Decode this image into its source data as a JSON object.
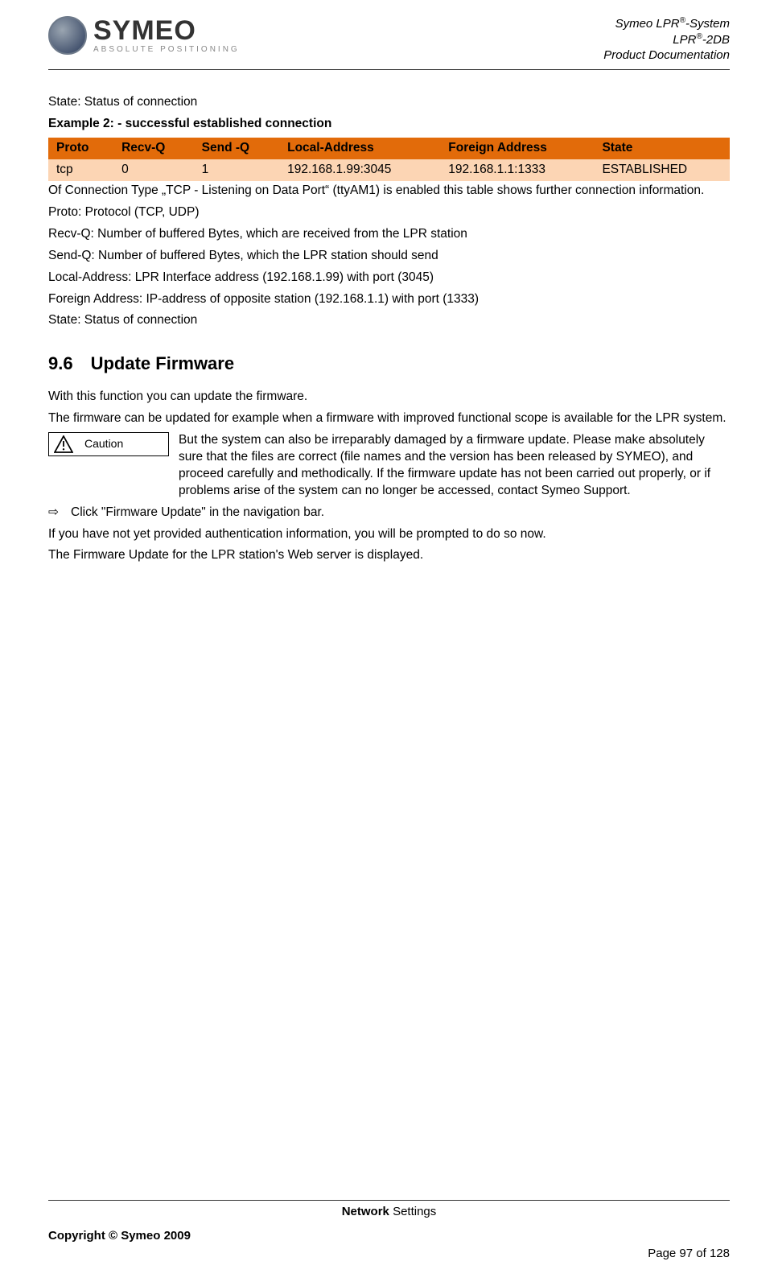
{
  "header": {
    "logo_main": "SYMEO",
    "logo_sub": "ABSOLUTE POSITIONING",
    "line1a": "Symeo LPR",
    "line1b": "-System",
    "line2a": "LPR",
    "line2b": "-2DB",
    "line3": "Product Documentation",
    "reg": "®"
  },
  "intro_state": "State: Status of connection",
  "example_title": "Example 2: - successful established connection",
  "table": {
    "headers": [
      "Proto",
      "Recv-Q",
      "Send -Q",
      "Local-Address",
      "Foreign Address",
      "State"
    ],
    "row": [
      "tcp",
      "0",
      "1",
      "192.168.1.99:3045",
      "192.168.1.1:1333",
      "ESTABLISHED"
    ]
  },
  "after_table": "Of Connection Type „TCP - Listening on Data Port“ (ttyAM1) is enabled this table shows further connection information.",
  "defs": [
    "Proto: Protocol (TCP, UDP)",
    "Recv-Q: Number of buffered Bytes, which are received from the LPR station",
    "Send-Q: Number of buffered Bytes, which the LPR station should send",
    "Local-Address: LPR Interface address (192.168.1.99) with port (3045)",
    "Foreign Address: IP-address of opposite station (192.168.1.1) with port (1333)",
    "State: Status of connection"
  ],
  "section": {
    "num": "9.6",
    "title": "Update Firmware"
  },
  "fw_p1": "With this function you can update the firmware.",
  "fw_p2": "The firmware can be updated for example when a firmware with improved functional scope is available for the LPR system.",
  "caution_label": "Caution",
  "caution_text": "But the system can also be irreparably damaged by a firmware update. Please make absolutely sure that the files are correct (file names and the version has been released by SYMEO), and proceed carefully and methodically. If the firmware update has not been carried out properly, or if problems arise of the system can no longer be accessed, contact Symeo Support.",
  "arrow_sym": "⇨",
  "arrow_text": "Click \"Firmware Update\" in the navigation bar.",
  "fw_p3": "If you have not yet provided authentication information, you will be prompted to do so now.",
  "fw_p4": "The Firmware Update for the LPR station's Web server is displayed.",
  "footer": {
    "center_bold": "Network",
    "center_rest": " Settings",
    "copyright": "Copyright © Symeo 2009",
    "page": "Page 97 of 128"
  }
}
